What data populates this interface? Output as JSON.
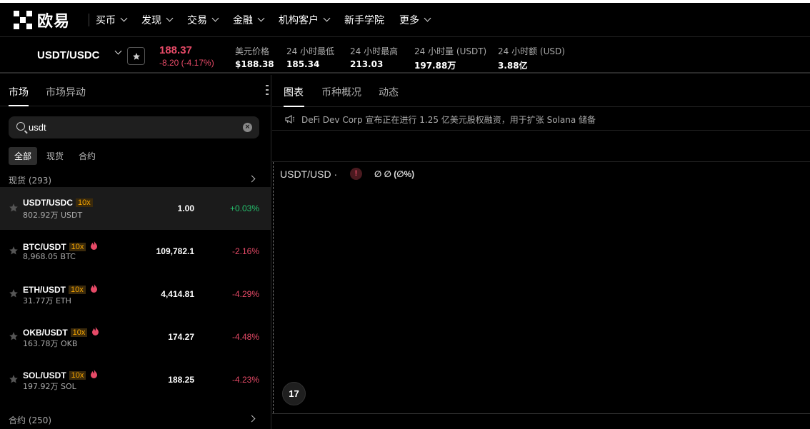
{
  "brand": {
    "name": "欧易"
  },
  "nav": {
    "items": [
      {
        "label": "买币",
        "dropdown": true
      },
      {
        "label": "发现",
        "dropdown": true
      },
      {
        "label": "交易",
        "dropdown": true
      },
      {
        "label": "金融",
        "dropdown": true
      },
      {
        "label": "机构客户",
        "dropdown": true
      },
      {
        "label": "新手学院",
        "dropdown": false
      },
      {
        "label": "更多",
        "dropdown": true
      }
    ]
  },
  "ticker": {
    "pair": "USDT/USDC",
    "price": "188.37",
    "change": "-8.20 (-4.17%)",
    "stats": [
      {
        "label": "美元价格",
        "value": "$188.38"
      },
      {
        "label": "24 小时最低",
        "value": "185.34"
      },
      {
        "label": "24 小时最高",
        "value": "213.03"
      },
      {
        "label": "24 小时量 (USDT)",
        "value": "197.88万"
      },
      {
        "label": "24 小时额 (USD)",
        "value": "3.88亿"
      }
    ]
  },
  "left": {
    "tabs": [
      "市场",
      "市场异动"
    ],
    "search": {
      "value": "usdt"
    },
    "filters": [
      "全部",
      "现货",
      "合约"
    ],
    "spot_header": "现货 (293)",
    "futures_header": "合约 (250)",
    "rows": [
      {
        "symbol": "USDT/USDC",
        "leverage": "10x",
        "hot": false,
        "volume": "802.92万 USDT",
        "last": "1.00",
        "change": "+0.03%",
        "dir": "pos"
      },
      {
        "symbol": "BTC/USDT",
        "leverage": "10x",
        "hot": true,
        "volume": "8,968.05 BTC",
        "last": "109,782.1",
        "change": "-2.16%",
        "dir": "neg"
      },
      {
        "symbol": "ETH/USDT",
        "leverage": "10x",
        "hot": true,
        "volume": "31.77万 ETH",
        "last": "4,414.81",
        "change": "-4.29%",
        "dir": "neg"
      },
      {
        "symbol": "OKB/USDT",
        "leverage": "10x",
        "hot": true,
        "volume": "163.78万 OKB",
        "last": "174.27",
        "change": "-4.48%",
        "dir": "neg"
      },
      {
        "symbol": "SOL/USDT",
        "leverage": "10x",
        "hot": true,
        "volume": "197.92万 SOL",
        "last": "188.25",
        "change": "-4.23%",
        "dir": "neg"
      }
    ]
  },
  "right": {
    "tabs": [
      "图表",
      "币种概况",
      "动态"
    ],
    "news": "DeFi Dev Corp 宣布正在进行 1.25 亿美元股权融资，用于扩张 Solana 储备",
    "chart_title": "USDT/USD ·",
    "warn": "!",
    "ohlc": "∅ ∅ (∅%)",
    "tv_logo": "17"
  },
  "colors": {
    "up": "#25c26e",
    "down": "#e64a67",
    "leverage": "#f7a600"
  }
}
